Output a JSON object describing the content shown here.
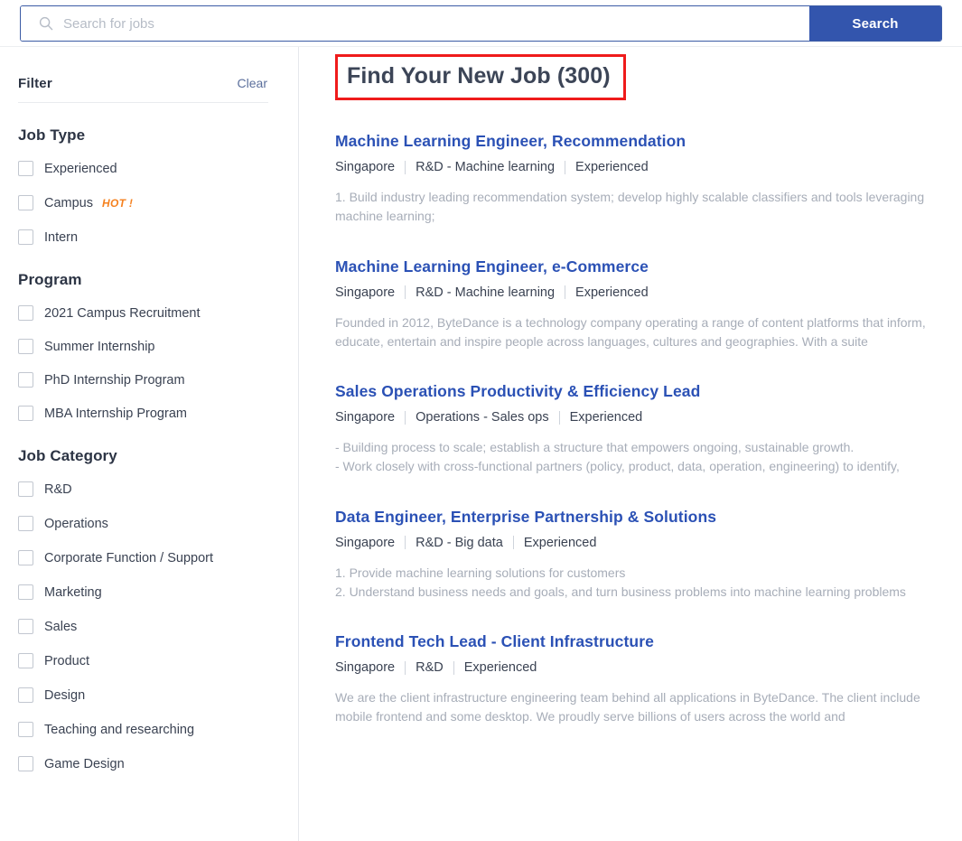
{
  "search": {
    "placeholder": "Search for jobs",
    "value": "",
    "button_label": "Search",
    "icon": "search-icon",
    "button_color": "#3355ad",
    "border_color": "#3b5ba5"
  },
  "sidebar": {
    "filter_label": "Filter",
    "clear_label": "Clear",
    "groups": [
      {
        "title": "Job Type",
        "options": [
          {
            "label": "Experienced",
            "checked": false,
            "badge": null
          },
          {
            "label": "Campus",
            "checked": false,
            "badge": "HOT !"
          },
          {
            "label": "Intern",
            "checked": false,
            "badge": null
          }
        ]
      },
      {
        "title": "Program",
        "options": [
          {
            "label": "2021 Campus Recruitment",
            "checked": false,
            "badge": null
          },
          {
            "label": "Summer Internship",
            "checked": false,
            "badge": null
          },
          {
            "label": "PhD Internship Program",
            "checked": false,
            "badge": null
          },
          {
            "label": "MBA Internship Program",
            "checked": false,
            "badge": null
          }
        ]
      },
      {
        "title": "Job Category",
        "options": [
          {
            "label": "R&D",
            "checked": false,
            "badge": null
          },
          {
            "label": "Operations",
            "checked": false,
            "badge": null
          },
          {
            "label": "Corporate Function / Support",
            "checked": false,
            "badge": null
          },
          {
            "label": "Marketing",
            "checked": false,
            "badge": null
          },
          {
            "label": "Sales",
            "checked": false,
            "badge": null
          },
          {
            "label": "Product",
            "checked": false,
            "badge": null
          },
          {
            "label": "Design",
            "checked": false,
            "badge": null
          },
          {
            "label": "Teaching and researching",
            "checked": false,
            "badge": null
          },
          {
            "label": "Game Design",
            "checked": false,
            "badge": null
          }
        ]
      }
    ],
    "badge_color": "#f5811f"
  },
  "main": {
    "page_title": "Find Your New Job (300)",
    "highlight_color": "#ef1b1b",
    "jobs": [
      {
        "title": "Machine Learning Engineer, Recommendation",
        "location": "Singapore",
        "category": "R&D - Machine learning",
        "type": "Experienced",
        "description": "1. Build industry leading recommendation system; develop highly scalable classifiers and tools leveraging machine learning;"
      },
      {
        "title": "Machine Learning Engineer, e-Commerce",
        "location": "Singapore",
        "category": "R&D - Machine learning",
        "type": "Experienced",
        "description": "Founded in 2012, ByteDance is a technology company operating a range of content platforms that inform, educate, entertain and inspire people across languages, cultures and geographies. With a suite"
      },
      {
        "title": "Sales Operations Productivity & Efficiency Lead",
        "location": "Singapore",
        "category": "Operations - Sales ops",
        "type": "Experienced",
        "description": "- Building process to scale; establish a structure that empowers ongoing, sustainable growth.\n- Work closely with cross-functional partners (policy, product, data, operation, engineering) to identify,"
      },
      {
        "title": "Data Engineer, Enterprise Partnership & Solutions",
        "location": "Singapore",
        "category": "R&D - Big data",
        "type": "Experienced",
        "description": "1. Provide machine learning solutions for customers\n2. Understand business needs and goals, and turn business problems into machine learning problems"
      },
      {
        "title": "Frontend Tech Lead - Client Infrastructure",
        "location": "Singapore",
        "category": "R&D",
        "type": "Experienced",
        "description": "We are the client infrastructure engineering team behind all applications in ByteDance. The client include mobile frontend and some desktop. We proudly serve billions of users across the world and"
      }
    ]
  }
}
